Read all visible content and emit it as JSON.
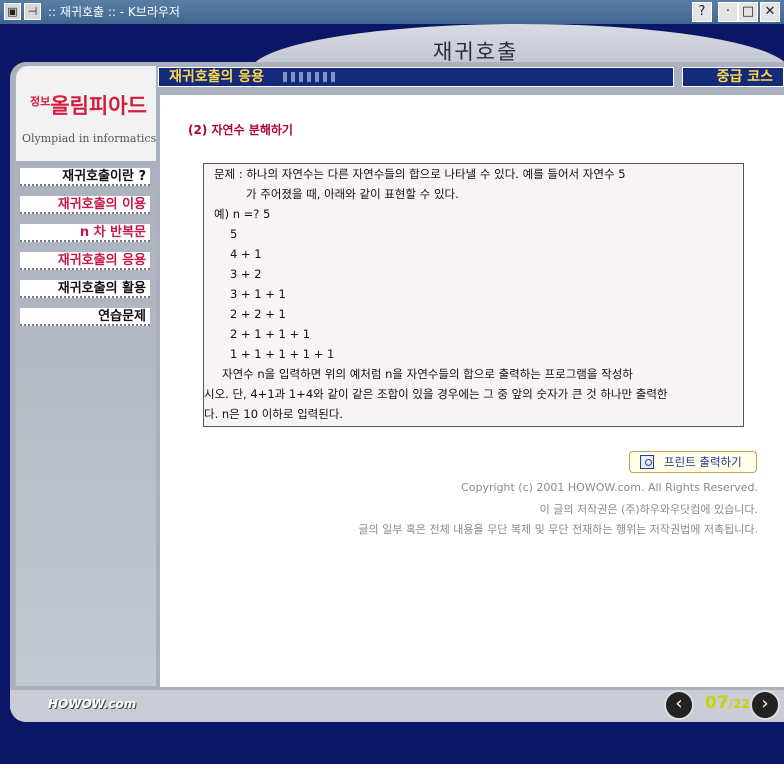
{
  "window": {
    "title": ":: 재귀호출 :: - K브라우저",
    "buttons": [
      "?",
      "·",
      "□",
      "✕"
    ]
  },
  "header": {
    "page_title": "재귀호출",
    "section_label": "재귀호출의 응용",
    "level_label": "중급 코스"
  },
  "logo": {
    "korean_small": "정보",
    "korean": "올림피아드",
    "english": "Olympiad in informatics"
  },
  "sidebar": {
    "items": [
      {
        "label": "재귀호출이란 ?",
        "color": "#111111"
      },
      {
        "label": "재귀호출의 이용",
        "color": "#c8174a"
      },
      {
        "label": "n 차 반복문",
        "color": "#c8174a"
      },
      {
        "label": "재귀호출의 응용",
        "color": "#c8174a"
      },
      {
        "label": "재귀호출의 활용",
        "color": "#111111"
      },
      {
        "label": "연습문제",
        "color": "#111111"
      }
    ]
  },
  "main": {
    "section_title": "(2) 자연수 분해하기",
    "problem_lines": [
      "문제 : 하나의 자연수는 다른 자연수들의 합으로 나타낼 수 있다. 예를 들어서 자연수 5",
      "가 주어졌을 때, 아래와 같이 표현할 수 있다.",
      "예) n =? 5",
      "5",
      "4 + 1",
      "3 + 2",
      "3 + 1 + 1",
      "2 + 2 + 1",
      "2 + 1 + 1 + 1",
      "1 + 1 + 1 + 1 + 1",
      "자연수 n을 입력하면 위의 예처럼 n을 자연수들의 합으로 출력하는 프로그램을 작성하",
      "시오. 단, 4+1과 1+4와 같이 같은 조합이 있을 경우에는 그 중 앞의 숫자가 큰 것 하나만 출력한",
      "다. n은 10 이하로 입력된다."
    ],
    "print_button": "프린트 출력하기",
    "copyright": [
      "Copyright (c) 2001 HOWOW.com. All Rights Reserved.",
      "이 글의 저작권은 (주)하우와우닷컴에 있습니다.",
      "글의 일부 혹은 전체 내용을 무단 복제 및 무단 전재하는 행위는 저작권법에 저촉됩니다."
    ]
  },
  "footer": {
    "brand": "HOWOW.com",
    "page_current": "07",
    "page_separator": "/",
    "page_total": "22",
    "prev_icon": "chevron-left-icon",
    "next_icon": "chevron-right-icon"
  },
  "colors": {
    "accent_yellow": "#ffd84a",
    "nav_blue": "#142a7a",
    "title_red": "#b00040"
  }
}
